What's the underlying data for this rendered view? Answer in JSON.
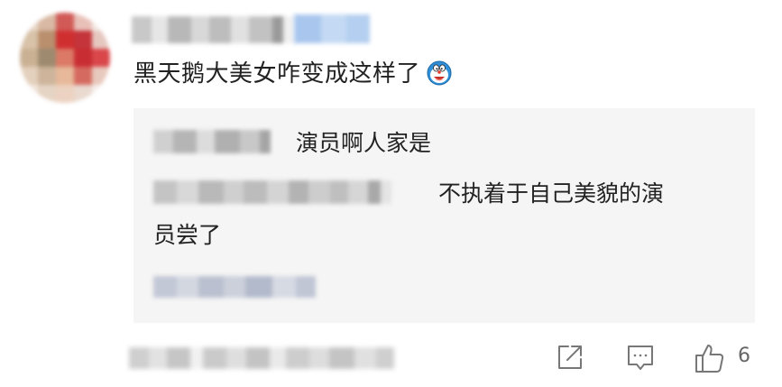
{
  "comment": {
    "text": "黑天鹅大美女咋变成这样了",
    "emoji": "doraemon-emoji-icon"
  },
  "replies": [
    {
      "text": "演员啊人家是"
    },
    {
      "text_line1": "不执着于自己美貌的演",
      "text_line2": "员尝了"
    }
  ],
  "actions": {
    "share": "share-icon",
    "reply": "reply-icon",
    "like": "thumbs-up-icon",
    "like_count": "6"
  },
  "colors": {
    "reply_box_bg": "#f5f5f5",
    "icon_gray": "#777777",
    "text": "#222222"
  }
}
